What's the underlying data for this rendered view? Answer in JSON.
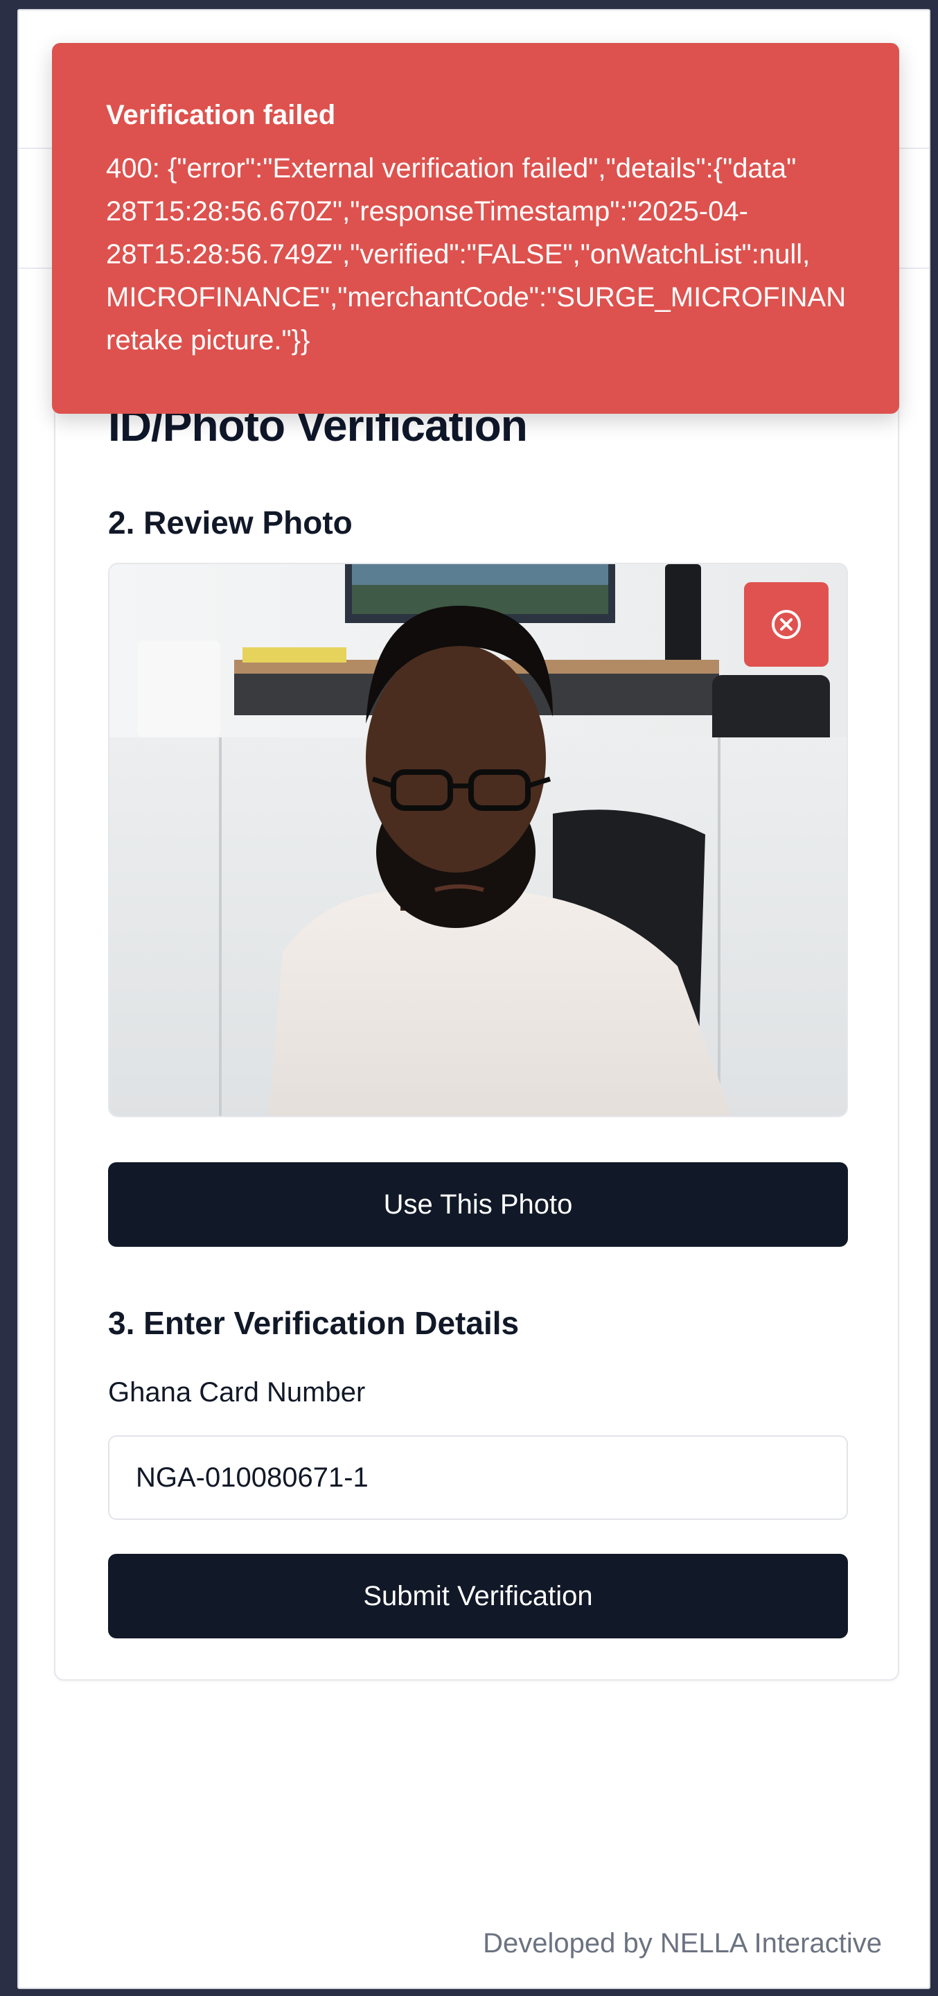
{
  "toast": {
    "title": "Verification failed",
    "message": "400: {\"error\":\"External verification failed\",\"details\":{\"data\"\n28T15:28:56.670Z\",\"responseTimestamp\":\"2025-04-\n28T15:28:56.749Z\",\"verified\":\"FALSE\",\"onWatchList\":null,\nMICROFINANCE\",\"merchantCode\":\"SURGE_MICROFINAN\nretake picture.\"}}",
    "color": "#dd524e"
  },
  "card": {
    "title": "ID/Photo Verification",
    "review_section": "2. Review Photo",
    "remove_icon": "circle-x-icon",
    "use_photo_label": "Use This Photo",
    "details_section": "3. Enter Verification Details",
    "ghana_card_label": "Ghana Card Number",
    "ghana_card_value": "NGA-010080671-1",
    "submit_label": "Submit Verification"
  },
  "footer": {
    "text": "Developed by NELLA Interactive"
  },
  "colors": {
    "button_dark": "#111827",
    "danger": "#e0524f",
    "frame_bg": "#2b2f45"
  }
}
